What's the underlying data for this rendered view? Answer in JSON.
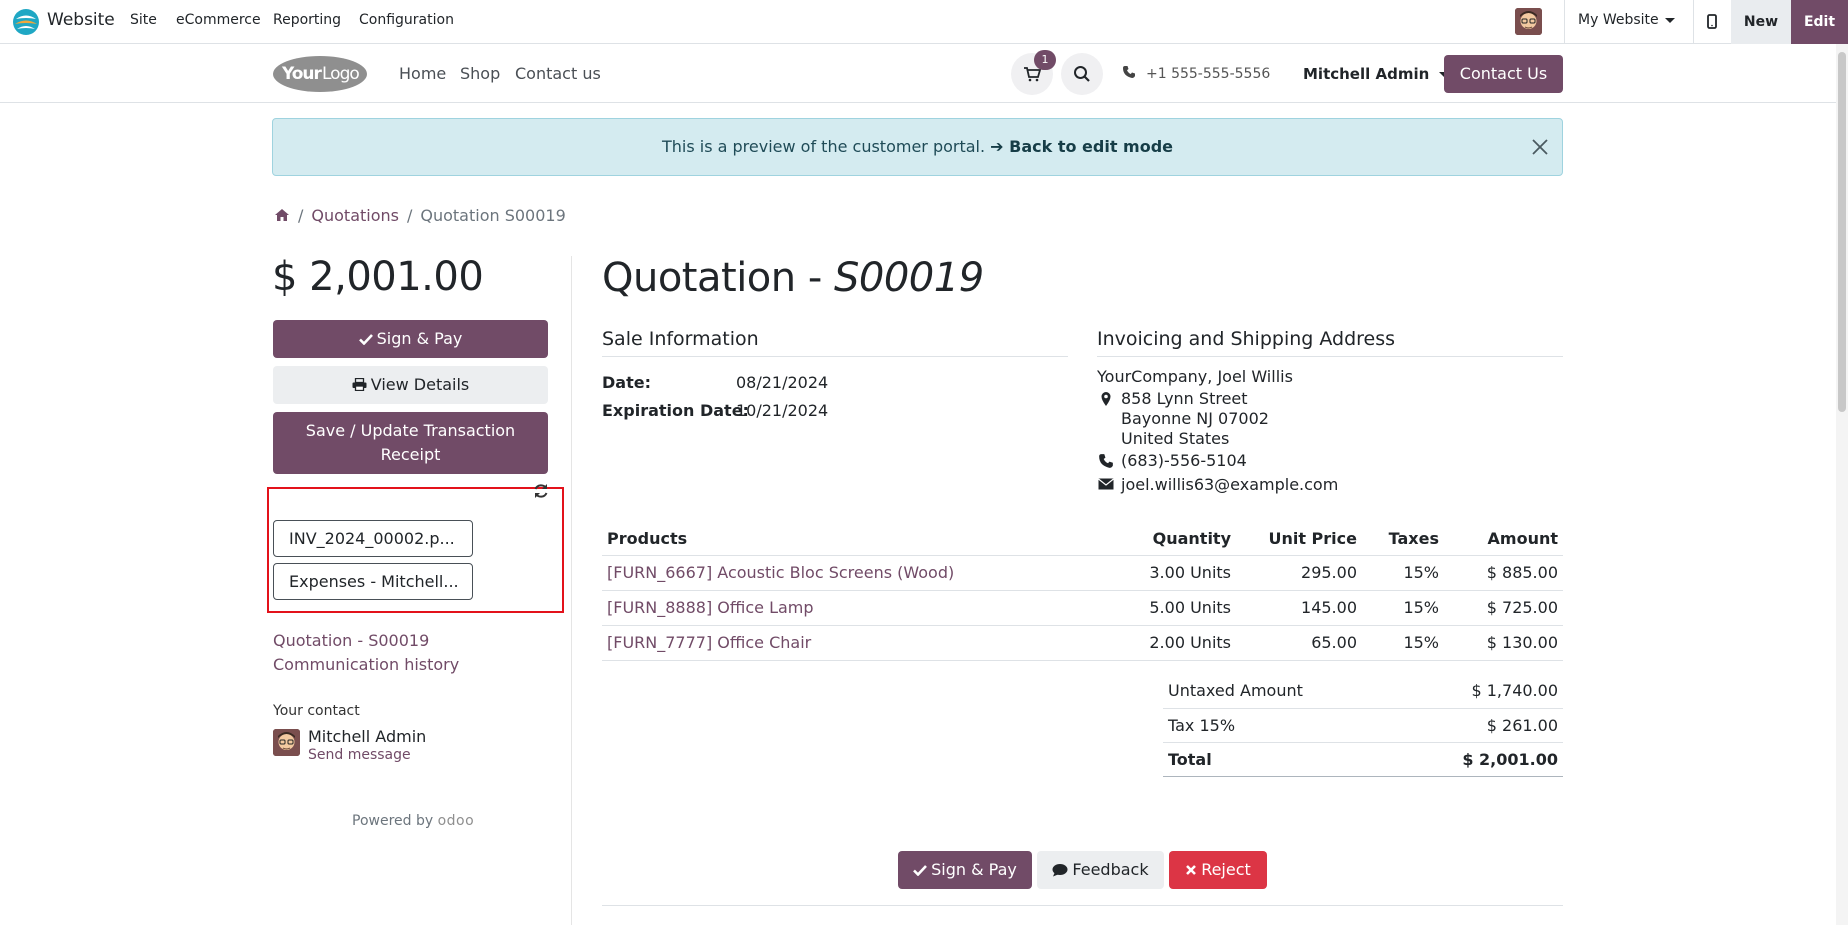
{
  "adminbar": {
    "app_name": "Website",
    "menus": [
      "Site",
      "eCommerce",
      "Reporting",
      "Configuration"
    ],
    "website_selector": "My Website",
    "new_label": "New",
    "edit_label": "Edit"
  },
  "header": {
    "logo_text": "YourLogo",
    "nav": [
      "Home",
      "Shop",
      "Contact us"
    ],
    "cart_count": "1",
    "phone": "+1 555-555-5556",
    "user": "Mitchell Admin",
    "contact_button": "Contact Us"
  },
  "alert": {
    "text": "This is a preview of the customer portal.",
    "link": "➔ Back to edit mode"
  },
  "breadcrumb": {
    "items": [
      "Quotations",
      "Quotation S00019"
    ]
  },
  "sidebar": {
    "amount": "$ 2,001.00",
    "sign_pay": "Sign & Pay",
    "view_details": "View Details",
    "save_update": "Save / Update Transaction Receipt",
    "attachments": [
      "INV_2024_00002.p...",
      "Expenses - Mitchell..."
    ],
    "history_link_1": "Quotation - S00019",
    "history_link_2": "Communication history",
    "your_contact_label": "Your contact",
    "contact_name": "Mitchell Admin",
    "send_message": "Send message",
    "powered_by": "Powered by",
    "powered_brand": "odoo"
  },
  "main": {
    "title_prefix": "Quotation -",
    "title_ref": "S00019",
    "sale_info_heading": "Sale Information",
    "date_label": "Date:",
    "date_value": "08/21/2024",
    "expiration_label": "Expiration Date:",
    "expiration_value": "10/21/2024",
    "address_heading": "Invoicing and Shipping Address",
    "address": {
      "company": "YourCompany, Joel Willis",
      "street": "858 Lynn Street",
      "city": "Bayonne NJ 07002",
      "country": "United States",
      "phone": "(683)-556-5104",
      "email": "joel.willis63@example.com"
    },
    "table": {
      "headers": [
        "Products",
        "Quantity",
        "Unit Price",
        "Taxes",
        "Amount"
      ],
      "rows": [
        [
          "[FURN_6667] Acoustic Bloc Screens (Wood)",
          "3.00 Units",
          "295.00",
          "15%",
          "$ 885.00"
        ],
        [
          "[FURN_8888] Office Lamp",
          "5.00 Units",
          "145.00",
          "15%",
          "$ 725.00"
        ],
        [
          "[FURN_7777] Office Chair",
          "2.00 Units",
          "65.00",
          "15%",
          "$ 130.00"
        ]
      ]
    },
    "totals": {
      "untaxed_label": "Untaxed Amount",
      "untaxed_value": "$ 1,740.00",
      "tax_label": "Tax 15%",
      "tax_value": "$ 261.00",
      "total_label": "Total",
      "total_value": "$ 2,001.00"
    },
    "actions": {
      "sign_pay": "Sign & Pay",
      "feedback": "Feedback",
      "reject": "Reject"
    }
  },
  "colors": {
    "brand": "#714b67",
    "danger": "#dc3545",
    "highlight": "#e3121b"
  }
}
